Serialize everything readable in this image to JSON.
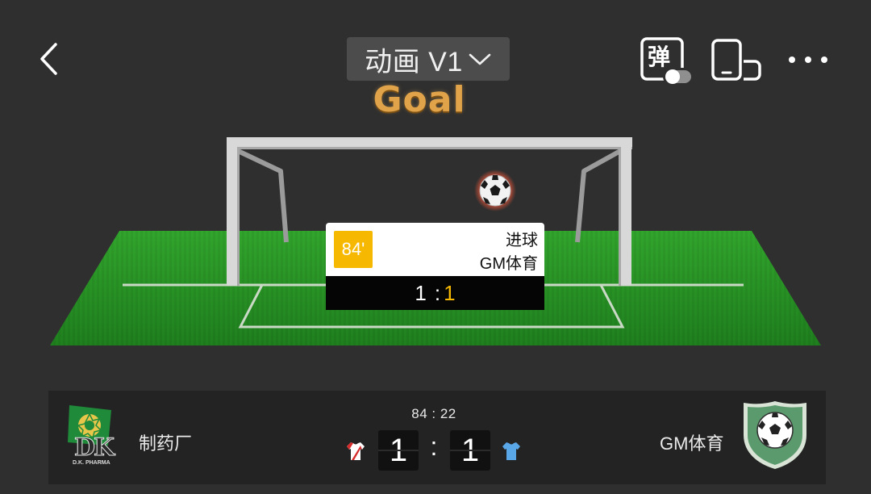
{
  "header": {
    "title": "动画 V1",
    "danmaku_label": "弹"
  },
  "animation": {
    "event_banner": "Goal"
  },
  "event_card": {
    "minute": "84'",
    "event_type": "进球",
    "team": "GM体育",
    "score_home": "1",
    "score_separator": ":",
    "score_away": "1"
  },
  "match": {
    "clock": "84 : 22",
    "home_team": "制药厂",
    "away_team": "GM体育",
    "home_score": "1",
    "away_score": "1",
    "score_separator": ":",
    "home_logo_text": "DK",
    "home_logo_caption": "D.K. PHARMA"
  },
  "colors": {
    "accent": "#f6b800",
    "pitch": "#2f9a2a",
    "banner": "#e0a349",
    "away_badge": "#5b9a6c",
    "home_kit": "#d62b2b",
    "away_kit": "#5aa7e8"
  },
  "icons": [
    "back-icon",
    "chevron-down-icon",
    "danmaku-icon",
    "rotate-screen-icon",
    "more-icon",
    "soccer-ball-icon",
    "home-kit-icon",
    "away-kit-icon"
  ]
}
